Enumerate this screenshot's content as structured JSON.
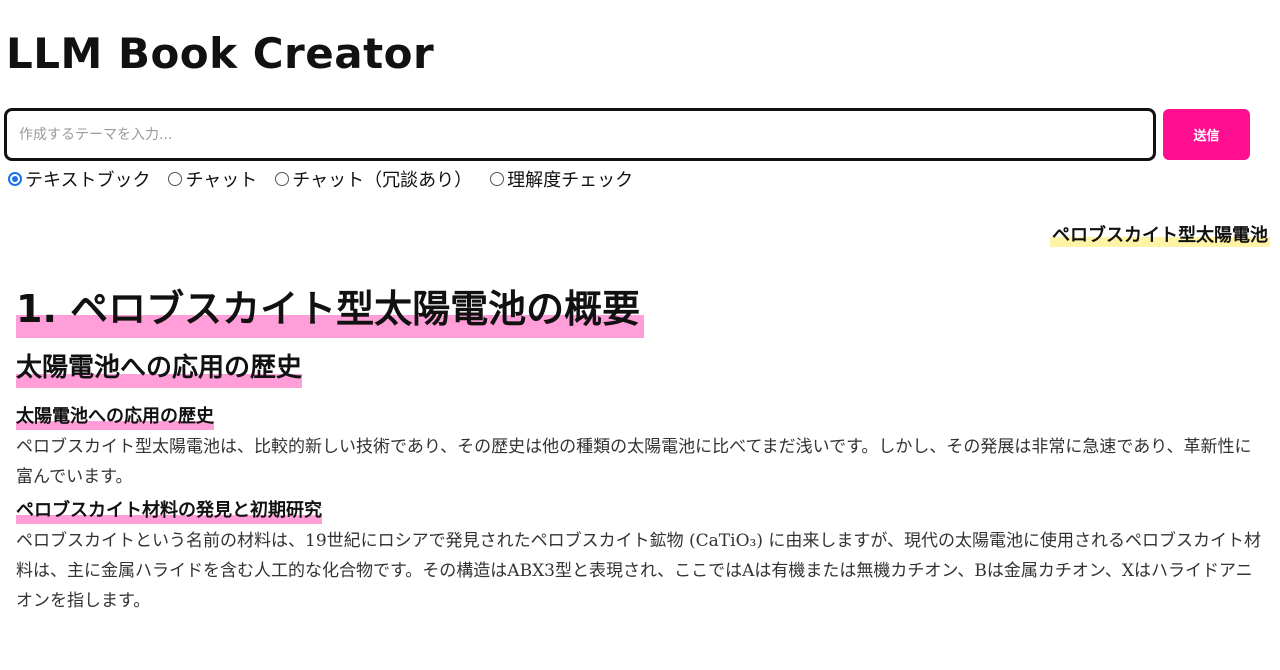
{
  "app": {
    "title": "LLM Book Creator"
  },
  "input": {
    "placeholder": "作成するテーマを入力...",
    "value": "",
    "submit_label": "送信"
  },
  "modes": [
    {
      "label": "テキストブック",
      "checked": true
    },
    {
      "label": "チャット",
      "checked": false
    },
    {
      "label": "チャット（冗談あり）",
      "checked": false
    },
    {
      "label": "理解度チェック",
      "checked": false
    }
  ],
  "topic_tag": "ペロブスカイト型太陽電池",
  "book": {
    "chapter_title": "1. ペロブスカイト型太陽電池の概要",
    "section_title": "太陽電池への応用の歴史",
    "subsections": [
      {
        "heading": "太陽電池への応用の歴史",
        "text": "ペロブスカイト型太陽電池は、比較的新しい技術であり、その歴史は他の種類の太陽電池に比べてまだ浅いです。しかし、その発展は非常に急速であり、革新性に富んでいます。"
      },
      {
        "heading": "ペロブスカイト材料の発見と初期研究",
        "text": "ペロブスカイトという名前の材料は、19世紀にロシアで発見されたペロブスカイト鉱物 (CaTiO₃) に由来しますが、現代の太陽電池に使用されるペロブスカイト材料は、主に金属ハライドを含む人工的な化合物です。その構造はABX3型と表現され、ここではAは有機または無機カチオン、Bは金属カチオン、Xはハライドアニオンを指します。"
      }
    ]
  },
  "colors": {
    "accent": "#ff0f8f",
    "heading_highlight": "#ff9ed8",
    "tag_highlight": "#fff3a6",
    "radio_checked": "#1a73e8"
  }
}
